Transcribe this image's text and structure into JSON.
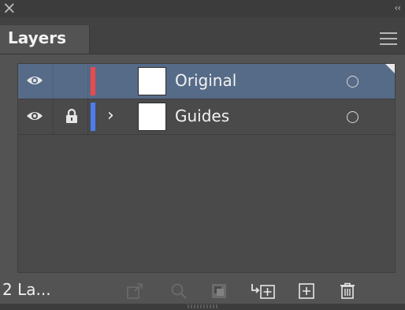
{
  "window": {
    "close_icon": "close-icon",
    "close_glyph": "×",
    "collapse_icon": "collapse-double-chevron-icon",
    "collapse_glyph": "‹‹"
  },
  "panel": {
    "tab_label": "Layers",
    "menu_icon": "hamburger-menu-icon"
  },
  "layers": [
    {
      "name": "Original",
      "visible": true,
      "locked": false,
      "expandable": false,
      "selected": true,
      "color": "#e84a4f"
    },
    {
      "name": "Guides",
      "visible": true,
      "locked": true,
      "expandable": true,
      "selected": false,
      "color": "#4f7cf0",
      "chevron": "›"
    }
  ],
  "footer": {
    "layer_count_label": "2 La...",
    "icons": [
      "export-icon",
      "locate-object-icon",
      "make-clipping-mask-icon",
      "create-sublayer-icon",
      "create-new-layer-icon",
      "delete-icon"
    ]
  },
  "colors": {
    "panel_bg": "#535353",
    "selected_row": "#566b87"
  }
}
